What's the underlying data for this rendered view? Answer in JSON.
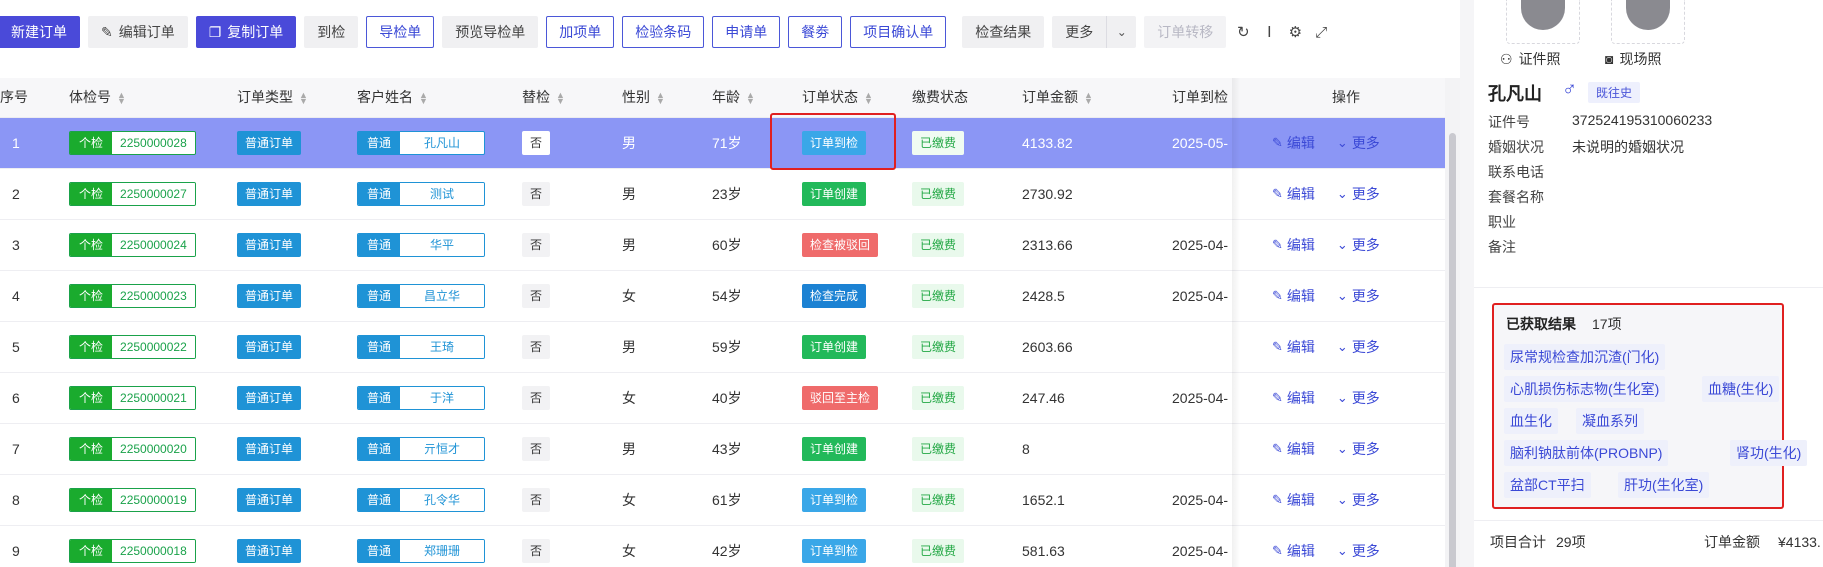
{
  "toolbar": {
    "new_order": "新建订单",
    "edit_order": "编辑订单",
    "copy_order": "复制订单",
    "arrive": "到检",
    "guide_sheet": "导检单",
    "preview_guide": "预览导检单",
    "add_item": "加项单",
    "barcode": "检验条码",
    "apply_sheet": "申请单",
    "meal_ticket": "餐劵",
    "item_confirm": "项目确认单",
    "check_result": "检查结果",
    "more": "更多",
    "transfer": "订单转移",
    "icons": [
      "refresh-icon",
      "column-height-icon",
      "settings-icon",
      "fullscreen-icon"
    ]
  },
  "columns": [
    "序号",
    "体检号",
    "订单类型",
    "客户姓名",
    "替检",
    "性别",
    "年龄",
    "订单状态",
    "缴费状态",
    "订单金额",
    "订单到检日期",
    "操作"
  ],
  "rows": [
    {
      "idx": "1",
      "ptype": "个检",
      "pid": "2250000028",
      "otype": "普通订单",
      "ctype": "普通",
      "name": "孔凡山",
      "sub": "否",
      "sex": "男",
      "age": "71岁",
      "status": "订单到检",
      "status_color": "#3aa7e8",
      "pay": "已缴费",
      "amount": "4133.82",
      "date": "2025-05-",
      "edit": "编辑",
      "more": "更多"
    },
    {
      "idx": "2",
      "ptype": "个检",
      "pid": "2250000027",
      "otype": "普通订单",
      "ctype": "普通",
      "name": "测试",
      "sub": "否",
      "sex": "男",
      "age": "23岁",
      "status": "订单创建",
      "status_color": "#22b95a",
      "pay": "已缴费",
      "amount": "2730.92",
      "date": "",
      "edit": "编辑",
      "more": "更多"
    },
    {
      "idx": "3",
      "ptype": "个检",
      "pid": "2250000024",
      "otype": "普通订单",
      "ctype": "普通",
      "name": "华平",
      "sub": "否",
      "sex": "男",
      "age": "60岁",
      "status": "检查被驳回",
      "status_color": "#ef6b6b",
      "pay": "已缴费",
      "amount": "2313.66",
      "date": "2025-04-",
      "edit": "编辑",
      "more": "更多"
    },
    {
      "idx": "4",
      "ptype": "个检",
      "pid": "2250000023",
      "otype": "普通订单",
      "ctype": "普通",
      "name": "昌立华",
      "sub": "否",
      "sex": "女",
      "age": "54岁",
      "status": "检查完成",
      "status_color": "#1c82d3",
      "pay": "已缴费",
      "amount": "2428.5",
      "date": "2025-04-",
      "edit": "编辑",
      "more": "更多"
    },
    {
      "idx": "5",
      "ptype": "个检",
      "pid": "2250000022",
      "otype": "普通订单",
      "ctype": "普通",
      "name": "王琦",
      "sub": "否",
      "sex": "男",
      "age": "59岁",
      "status": "订单创建",
      "status_color": "#22b95a",
      "pay": "已缴费",
      "amount": "2603.66",
      "date": "",
      "edit": "编辑",
      "more": "更多"
    },
    {
      "idx": "6",
      "ptype": "个检",
      "pid": "2250000021",
      "otype": "普通订单",
      "ctype": "普通",
      "name": "于洋",
      "sub": "否",
      "sex": "女",
      "age": "40岁",
      "status": "驳回至主检",
      "status_color": "#ef6b6b",
      "pay": "已缴费",
      "amount": "247.46",
      "date": "2025-04-",
      "edit": "编辑",
      "more": "更多"
    },
    {
      "idx": "7",
      "ptype": "个检",
      "pid": "2250000020",
      "otype": "普通订单",
      "ctype": "普通",
      "name": "亓恒才",
      "sub": "否",
      "sex": "男",
      "age": "43岁",
      "status": "订单创建",
      "status_color": "#22b95a",
      "pay": "已缴费",
      "amount": "8",
      "date": "",
      "edit": "编辑",
      "more": "更多"
    },
    {
      "idx": "8",
      "ptype": "个检",
      "pid": "2250000019",
      "otype": "普通订单",
      "ctype": "普通",
      "name": "孔令华",
      "sub": "否",
      "sex": "女",
      "age": "61岁",
      "status": "订单到检",
      "status_color": "#3aa7e8",
      "pay": "已缴费",
      "amount": "1652.1",
      "date": "2025-04-",
      "edit": "编辑",
      "more": "更多"
    },
    {
      "idx": "9",
      "ptype": "个检",
      "pid": "2250000018",
      "otype": "普通订单",
      "ctype": "普通",
      "name": "郑珊珊",
      "sub": "否",
      "sex": "女",
      "age": "42岁",
      "status": "订单到检",
      "status_color": "#3aa7e8",
      "pay": "已缴费",
      "amount": "581.63",
      "date": "2025-04-",
      "edit": "编辑",
      "more": "更多"
    }
  ],
  "side": {
    "id_photo": "证件照",
    "scene_photo": "现场照",
    "name": "孔凡山",
    "gender_symbol": "♂",
    "history": "既往史",
    "fields": [
      {
        "label": "证件号",
        "value": "372524195310060233"
      },
      {
        "label": "婚姻状况",
        "value": "未说明的婚姻状况"
      },
      {
        "label": "联系电话",
        "value": ""
      },
      {
        "label": "套餐名称",
        "value": ""
      },
      {
        "label": "职业",
        "value": ""
      },
      {
        "label": "备注",
        "value": ""
      }
    ],
    "result_title": "已获取结果",
    "result_count": "17项",
    "results": [
      "尿常规检查加沉渣(门化)",
      "心肌损伤标志物(生化室)",
      "血糖(生化)",
      "血生化",
      "凝血系列",
      "脑利钠肽前体(PROBNP)",
      "肾功(生化)",
      "盆部CT平扫",
      "肝功(生化室)"
    ],
    "total_label": "项目合计",
    "total_value": "29项",
    "amount_label": "订单金额",
    "amount_value": "¥4133."
  }
}
